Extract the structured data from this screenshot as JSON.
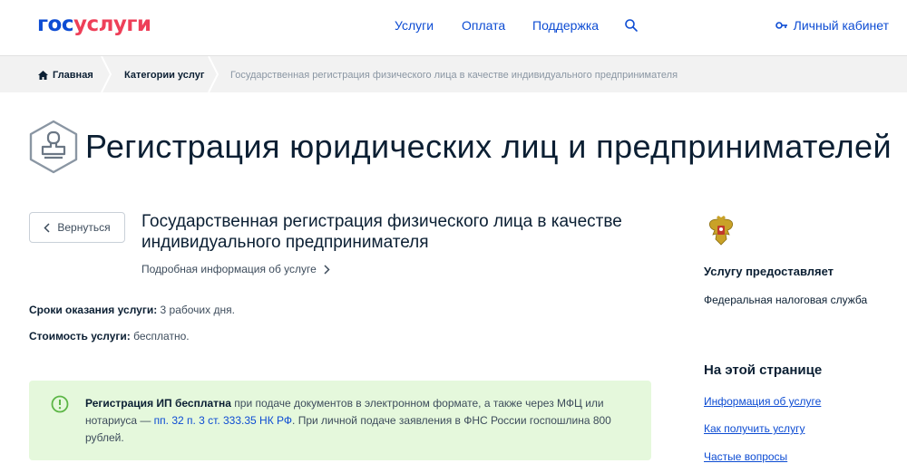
{
  "header": {
    "logo_part1": "гос",
    "logo_part2": "услуги",
    "nav": [
      "Услуги",
      "Оплата",
      "Поддержка"
    ],
    "cabinet": "Личный кабинет"
  },
  "breadcrumbs": {
    "home": "Главная",
    "category": "Категории услуг",
    "current": "Государственная регистрация физического лица в качестве индивидуального предпринимателя"
  },
  "page_title": "Регистрация юридических лиц и предпринимателей",
  "back_label": "Вернуться",
  "service": {
    "title": "Государственная регистрация физического лица в качестве индивидуального предпринимателя",
    "more_info": "Подробная информация об услуге",
    "terms_label": "Сроки оказания услуги:",
    "terms_value": " 3 рабочих дня.",
    "cost_label": "Стоимость услуги:",
    "cost_value": " бесплатно."
  },
  "notice": {
    "bold": "Регистрация ИП бесплатна",
    "text1": " при подаче документов в электронном формате, а также через МФЦ или нотариуса — ",
    "link": "пп. 32 п. 3 ст. 333.35 НК РФ",
    "text2": ". При личной подаче заявления в ФНС России госпошлина 800 рублей."
  },
  "sidebar": {
    "provider_title": "Услугу предоставляет",
    "provider_name": "Федеральная налоговая служба",
    "onpage_title": "На этой странице",
    "links": [
      "Информация об услуге",
      "Как получить услугу",
      "Частые вопросы"
    ]
  },
  "colors": {
    "brand_blue": "#0d4cd3",
    "brand_red": "#ee3f58",
    "notice_bg": "#e5f8dc",
    "notice_icon": "#5cb646"
  }
}
